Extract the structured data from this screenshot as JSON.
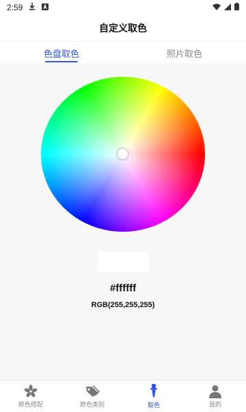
{
  "status_bar": {
    "time": "2:59"
  },
  "header": {
    "title": "自定义取色"
  },
  "tabs": [
    {
      "label": "色盘取色",
      "active": true
    },
    {
      "label": "照片取色",
      "active": false
    }
  ],
  "picker": {
    "selected_color": "#ffffff",
    "hex_text": "#ffffff",
    "rgb_text": "RGB(255,255,255)"
  },
  "bottom_nav": [
    {
      "label": "颜色搭配",
      "icon": "asterisk-icon",
      "active": false
    },
    {
      "label": "颜色类别",
      "icon": "tag-icon",
      "active": false
    },
    {
      "label": "取色",
      "icon": "eyedropper-icon",
      "active": true
    },
    {
      "label": "我的",
      "icon": "user-icon",
      "active": false
    }
  ],
  "colors": {
    "accent": "#2f54eb",
    "inactive": "#8a8a8a",
    "background": "#f7f7f7"
  }
}
